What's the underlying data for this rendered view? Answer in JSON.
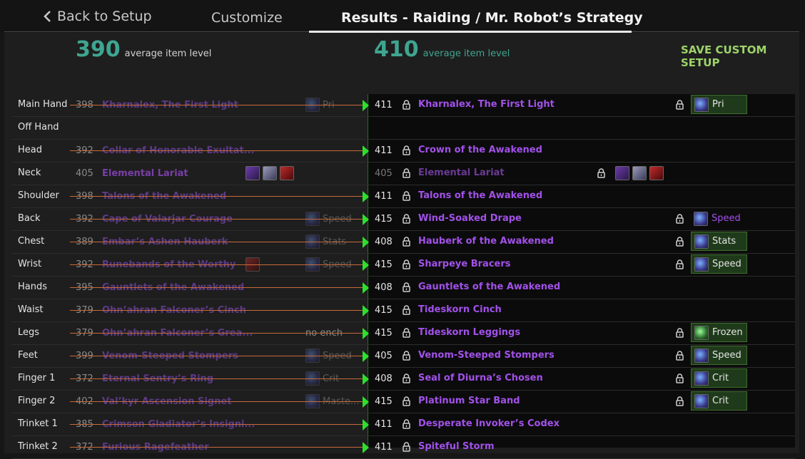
{
  "nav": {
    "back_label": "Back to Setup",
    "customize_label": "Customize",
    "results_label": "Results - Raiding / Mr. Robot’s Strategy"
  },
  "summary": {
    "current_ilvl": "390",
    "current_label": "average item level",
    "new_ilvl": "410",
    "new_label": "average item level",
    "save_label": "SAVE CUSTOM SETUP"
  },
  "colors": {
    "ilvl_accent": "#3fa590",
    "save_accent": "#9ed36a",
    "epic_item": "#a251ea",
    "changed_arrow": "#2ee02e",
    "strike_line": "#c96a3a",
    "enchant_box": "#1f3a1a"
  },
  "rows": [
    {
      "slot": "Main Hand",
      "cur_ilvl": "398",
      "cur_name": "Kharnalex, The First Light",
      "cur_ench": "Pri",
      "cur_ench_icon": "enchant-icon",
      "changed": true,
      "new_ilvl": "411",
      "new_name": "Kharnalex, The First Light",
      "new_ench": "Pri",
      "new_ench_icon": "enchant-icon",
      "new_ench_box": true
    },
    {
      "slot": "Off Hand",
      "cur_ilvl": "",
      "cur_name": "",
      "changed": false,
      "new_ilvl": "",
      "new_name": ""
    },
    {
      "slot": "Head",
      "cur_ilvl": "392",
      "cur_name": "Collar of Honorable Exultat...",
      "changed": true,
      "new_ilvl": "411",
      "new_name": "Crown of the Awakened"
    },
    {
      "slot": "Neck",
      "cur_ilvl": "405",
      "cur_name": "Elemental Lariat",
      "cur_gems": [
        "gem-purple",
        "gem-silver",
        "gem-red"
      ],
      "changed": false,
      "new_ilvl": "405",
      "new_name": "Elemental Lariat",
      "new_gems": [
        "gem-purple",
        "gem-silver",
        "gem-red"
      ],
      "new_dim": true
    },
    {
      "slot": "Shoulder",
      "cur_ilvl": "398",
      "cur_name": "Talons of the Awakened",
      "changed": true,
      "new_ilvl": "411",
      "new_name": "Talons of the Awakened"
    },
    {
      "slot": "Back",
      "cur_ilvl": "392",
      "cur_name": "Cape of Valarjar Courage",
      "cur_ench": "Speed",
      "cur_ench_icon": "enchant-icon",
      "changed": true,
      "new_ilvl": "415",
      "new_name": "Wind-Soaked Drape",
      "new_ench": "Speed",
      "new_ench_icon": "enchant-icon",
      "new_ench_box": false
    },
    {
      "slot": "Chest",
      "cur_ilvl": "389",
      "cur_name": "Embar’s Ashen Hauberk",
      "cur_ench": "Stats",
      "cur_ench_icon": "enchant-icon",
      "changed": true,
      "new_ilvl": "408",
      "new_name": "Hauberk of the Awakened",
      "new_ench": "Stats",
      "new_ench_icon": "enchant-icon",
      "new_ench_box": true
    },
    {
      "slot": "Wrist",
      "cur_ilvl": "392",
      "cur_name": "Runebands of the Worthy",
      "cur_gems": [
        "gem-red-faded"
      ],
      "cur_ench": "Speed",
      "cur_ench_icon": "enchant-icon",
      "changed": true,
      "new_ilvl": "415",
      "new_name": "Sharpeye Bracers",
      "new_ench": "Speed",
      "new_ench_icon": "enchant-icon",
      "new_ench_box": true
    },
    {
      "slot": "Hands",
      "cur_ilvl": "395",
      "cur_name": "Gauntlets of the Awakened",
      "changed": true,
      "new_ilvl": "408",
      "new_name": "Gauntlets of the Awakened"
    },
    {
      "slot": "Waist",
      "cur_ilvl": "379",
      "cur_name": "Ohn’ahran Falconer’s Cinch",
      "changed": true,
      "new_ilvl": "415",
      "new_name": "Tideskorn Cinch"
    },
    {
      "slot": "Legs",
      "cur_ilvl": "379",
      "cur_name": "Ohn’ahran Falconer’s Grea...",
      "cur_noench": "no ench",
      "changed": true,
      "new_ilvl": "415",
      "new_name": "Tideskorn Leggings",
      "new_ench": "Frozen",
      "new_ench_icon": "frost-icon",
      "new_ench_box": true
    },
    {
      "slot": "Feet",
      "cur_ilvl": "399",
      "cur_name": "Venom-Steeped Stompers",
      "cur_ench": "Speed",
      "cur_ench_icon": "enchant-icon",
      "changed": true,
      "new_ilvl": "405",
      "new_name": "Venom-Steeped Stompers",
      "new_ench": "Speed",
      "new_ench_icon": "enchant-icon",
      "new_ench_box": true
    },
    {
      "slot": "Finger 1",
      "cur_ilvl": "372",
      "cur_name": "Eternal Sentry’s Ring",
      "cur_ench": "Crit",
      "cur_ench_icon": "enchant-icon",
      "changed": true,
      "new_ilvl": "408",
      "new_name": "Seal of Diurna’s Chosen",
      "new_ench": "Crit",
      "new_ench_icon": "enchant-icon",
      "new_ench_box": true
    },
    {
      "slot": "Finger 2",
      "cur_ilvl": "402",
      "cur_name": "Val’kyr Ascension Signet",
      "cur_ench": "Maste...",
      "cur_ench_icon": "enchant-icon",
      "changed": true,
      "new_ilvl": "415",
      "new_name": "Platinum Star Band",
      "new_ench": "Crit",
      "new_ench_icon": "enchant-icon",
      "new_ench_box": true
    },
    {
      "slot": "Trinket 1",
      "cur_ilvl": "385",
      "cur_name": "Crimson Gladiator’s Insigni...",
      "changed": true,
      "new_ilvl": "411",
      "new_name": "Desperate Invoker’s Codex"
    },
    {
      "slot": "Trinket 2",
      "cur_ilvl": "372",
      "cur_name": "Furious Ragefeather",
      "changed": true,
      "new_ilvl": "411",
      "new_name": "Spiteful Storm"
    }
  ]
}
